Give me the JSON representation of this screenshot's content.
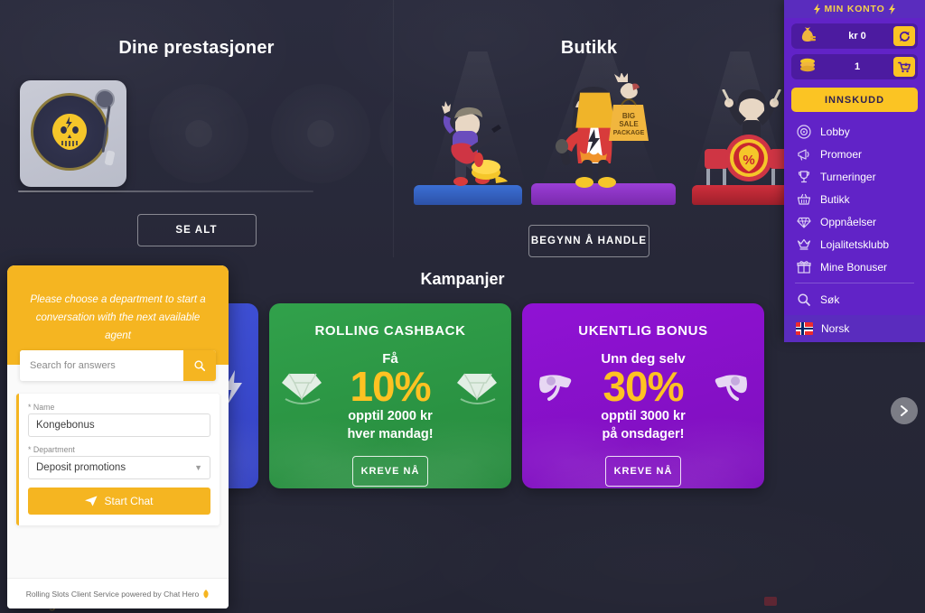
{
  "achievements": {
    "title": "Dine prestasjoner",
    "see_all_label": "SE ALT",
    "unlocked_icon": "vinyl-record-skull-icon",
    "locked_count": 3
  },
  "shop": {
    "title": "Butikk",
    "cta_label": "BEGYNN Å HANDLE",
    "bag_text": "BIG SALE PACKAGE"
  },
  "promotions": {
    "title": "Kampanjer",
    "next_arrow_icon": "chevron-right-icon",
    "cards": [
      {
        "id": "kongebonus",
        "heading": "",
        "sub": "",
        "percent": "",
        "line1": "",
        "line2": "",
        "cta": "",
        "color": "#4153d8",
        "side_icon": "lightning-icon"
      },
      {
        "id": "rolling-cashback",
        "heading": "ROLLING CASHBACK",
        "sub": "Få",
        "percent": "10%",
        "line1": "opptil 2000 kr",
        "line2": "hver mandag!",
        "cta": "KREVE NÅ",
        "color": "#31a14b",
        "side_icon": "diamond-icon"
      },
      {
        "id": "ukentlig-bonus",
        "heading": "UKENTLIG BONUS",
        "sub": "Unn deg selv",
        "percent": "30%",
        "line1": "opptil 3000 kr",
        "line2": "på onsdager!",
        "cta": "KREVE NÅ",
        "color": "#9012d4",
        "side_icon": "revolver-icon"
      }
    ]
  },
  "sidebar": {
    "title": "MIN KONTO",
    "title_icon": "lightning-bolt-icon",
    "balance": {
      "icon": "money-bag-icon",
      "value": "kr 0",
      "action_icon": "refresh-icon"
    },
    "coins": {
      "icon": "coin-stack-icon",
      "value": "1",
      "action_icon": "shopping-cart-icon"
    },
    "deposit_label": "INNSKUDD",
    "items": [
      {
        "label": "Lobby",
        "icon": "vinyl-disc-icon"
      },
      {
        "label": "Promoer",
        "icon": "megaphone-icon"
      },
      {
        "label": "Turneringer",
        "icon": "trophy-icon"
      },
      {
        "label": "Butikk",
        "icon": "basket-icon"
      },
      {
        "label": "Oppnåelser",
        "icon": "diamond-icon"
      },
      {
        "label": "Lojalitetsklubb",
        "icon": "crown-icon"
      },
      {
        "label": "Mine Bonuser",
        "icon": "gift-icon"
      }
    ],
    "search": {
      "label": "Søk",
      "icon": "search-icon"
    },
    "language": {
      "label": "Norsk",
      "icon": "norway-flag-icon"
    },
    "accent_color": "#6123c7",
    "accent_yellow": "#fbc423"
  },
  "chat": {
    "intro": "Please choose a department to start a conversation with the next available agent",
    "search_placeholder": "Search for answers",
    "search_icon": "search-icon",
    "name_label": "* Name",
    "name_value": "Kongebonus",
    "department_label": "* Department",
    "department_value": "Deposit promotions",
    "department_caret_icon": "chevron-down-icon",
    "start_label": "Start Chat",
    "start_icon": "send-plane-icon",
    "footer": "Rolling Slots Client Service powered by Chat Hero",
    "footer_icon": "flame-icon",
    "accent_color": "#f5b521"
  },
  "brand": "Rolling Slots"
}
